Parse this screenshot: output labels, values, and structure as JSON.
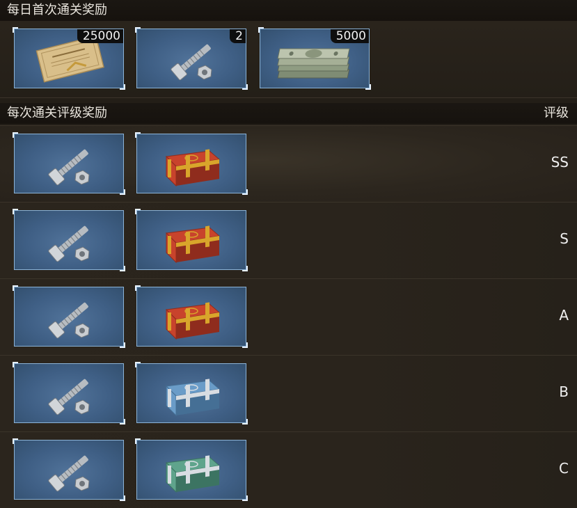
{
  "daily_first_clear": {
    "title": "每日首次通关奖励",
    "items": [
      {
        "icon": "certificate-icon",
        "count": "25000"
      },
      {
        "icon": "bolt-parts-icon",
        "count": "2"
      },
      {
        "icon": "cash-stack-icon",
        "count": "5000"
      }
    ]
  },
  "rating_rewards": {
    "title": "每次通关评级奖励",
    "grade_header": "评级",
    "rows": [
      {
        "grade": "SS",
        "items": [
          "bolt-parts-icon",
          "red-gold-chest-icon"
        ]
      },
      {
        "grade": "S",
        "items": [
          "bolt-parts-icon",
          "red-gold-chest-icon"
        ]
      },
      {
        "grade": "A",
        "items": [
          "bolt-parts-icon",
          "red-gold-chest-icon"
        ]
      },
      {
        "grade": "B",
        "items": [
          "bolt-parts-icon",
          "blue-silver-chest-icon"
        ]
      },
      {
        "grade": "C",
        "items": [
          "bolt-parts-icon",
          "green-silver-chest-icon"
        ]
      }
    ]
  },
  "colors": {
    "slot_border": "#8cb4d8",
    "slot_bg": "#3f5f85",
    "red_chest": "#c8432c",
    "blue_chest": "#6a9cc8",
    "green_chest": "#5fa48c",
    "gold_trim": "#d9a52b",
    "silver_trim": "#d8dde2"
  }
}
